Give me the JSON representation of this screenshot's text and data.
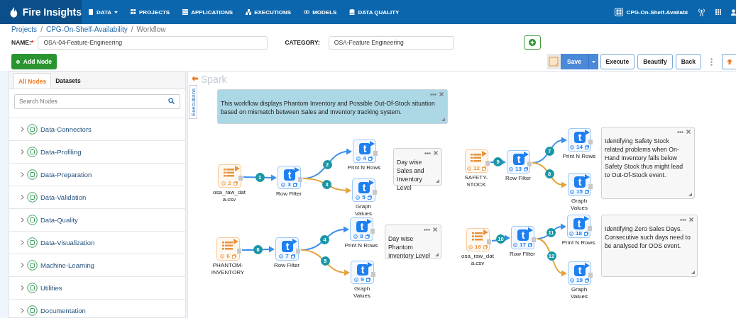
{
  "navbar": {
    "logo": "Fire Insights",
    "items": [
      {
        "label": "DATA",
        "dropdown": true
      },
      {
        "label": "PROJECTS",
        "dropdown": false
      },
      {
        "label": "APPLICATIONS",
        "dropdown": false
      },
      {
        "label": "EXECUTIONS",
        "dropdown": false
      },
      {
        "label": "MODELS",
        "dropdown": false
      },
      {
        "label": "DATA QUALITY",
        "dropdown": false
      }
    ],
    "project": "CPG-On-Shelf-Availabi"
  },
  "breadcrumb": {
    "separator": "/",
    "items": [
      "Projects",
      "CPG-On-Shelf-Availability",
      "Workflow"
    ]
  },
  "form": {
    "name_label": "NAME:",
    "required_mark": "*",
    "name_value": "OSA-04-Feature-Engineering",
    "category_label": "CATEGORY:",
    "category_value": "OSA-Feature Engineering"
  },
  "add_node": "Add Node",
  "toolbar": {
    "save": "Save",
    "buttons": [
      "Execute",
      "Beautify",
      "Back"
    ]
  },
  "sidebar": {
    "tabs": [
      {
        "label": "All Nodes",
        "selected": true
      },
      {
        "label": "Datasets",
        "selected": false
      }
    ],
    "search_placeholder": "Search Nodes",
    "categories": [
      {
        "label": "Data-Connectors",
        "expanded": false
      },
      {
        "label": "Data-Profiling",
        "expanded": false
      },
      {
        "label": "Data-Preparation",
        "expanded": false
      },
      {
        "label": "Data-Validation",
        "expanded": false
      },
      {
        "label": "Data-Quality",
        "expanded": false
      },
      {
        "label": "Data-Visualization",
        "expanded": false
      },
      {
        "label": "Machine-Learning",
        "expanded": false
      },
      {
        "label": "Utilities",
        "expanded": false
      },
      {
        "label": "Documentation",
        "expanded": false
      }
    ]
  },
  "canvas": {
    "engine": "Spark",
    "executions_tab": "Executions",
    "notes": [
      {
        "text": "This workflow displays Phantom Inventory and Possible Out-Of-Stock situation based on mismatch between Sales and Inventory tracking system.",
        "color": "#acd7e4"
      },
      {
        "text": "Day wise Sales and Inventory Level",
        "color": "#f7f7f8"
      },
      {
        "text": "Identifying Safety Stock related problems when On-Hand Inventory falls below Safety Stock thus might lead to Out-Of-Stock event.",
        "color": "#f7f7f8"
      },
      {
        "text": "Day wise Phantom Inventory Level",
        "color": "#f7f7f8"
      },
      {
        "text": "Identifying Zero Sales Days. Consecutive such days need to be analysed for OOS event.",
        "color": "#f7f7f8"
      }
    ],
    "nodes": [
      {
        "kind": "dataset",
        "number": "2",
        "label": "osa_raw_dat a.csv"
      },
      {
        "kind": "transform",
        "glyph": "t",
        "number": "3",
        "label": "Row Filter"
      },
      {
        "kind": "transform",
        "glyph": "t",
        "number": "4",
        "label": "Print N Rows"
      },
      {
        "kind": "transform",
        "glyph": "t",
        "number": "5",
        "label": "Graph Values"
      },
      {
        "kind": "dataset",
        "number": "12",
        "label": "SAFETY- STOCK"
      },
      {
        "kind": "transform",
        "glyph": "t",
        "number": "13",
        "label": "Row Filter"
      },
      {
        "kind": "transform",
        "glyph": "t",
        "number": "14",
        "label": "Print N Rows"
      },
      {
        "kind": "transform",
        "glyph": "t",
        "number": "15",
        "label": "Graph Values"
      },
      {
        "kind": "dataset",
        "number": "6",
        "label": "PHANTOM- INVENTORY"
      },
      {
        "kind": "transform",
        "glyph": "t",
        "number": "7",
        "label": "Row Filter"
      },
      {
        "kind": "transform",
        "glyph": "t",
        "number": "8",
        "label": "Print N Rows"
      },
      {
        "kind": "transform",
        "glyph": "t",
        "number": "9",
        "label": "Graph Values"
      },
      {
        "kind": "dataset",
        "number": "16",
        "label": "osa_raw_dat a.csv"
      },
      {
        "kind": "transform",
        "glyph": "t",
        "number": "17",
        "label": "Row Filter"
      },
      {
        "kind": "transform",
        "glyph": "t",
        "number": "18",
        "label": "Print N Rows"
      },
      {
        "kind": "transform",
        "glyph": "t",
        "number": "19",
        "label": "Graph Values"
      }
    ],
    "edges": [
      {
        "number": "1",
        "color": "#3b8fe8"
      },
      {
        "number": "2",
        "color": "#3b8fe8"
      },
      {
        "number": "3",
        "color": "#e2a43c"
      },
      {
        "number": "9",
        "color": "#3b8fe8"
      },
      {
        "number": "7",
        "color": "#3b8fe8"
      },
      {
        "number": "8",
        "color": "#e2a43c"
      },
      {
        "number": "6",
        "color": "#3b8fe8"
      },
      {
        "number": "4",
        "color": "#3b8fe8"
      },
      {
        "number": "5",
        "color": "#e2a43c"
      },
      {
        "number": "10",
        "color": "#3b8fe8"
      },
      {
        "number": "11",
        "color": "#3b8fe8"
      },
      {
        "number": "12",
        "color": "#e2a43c"
      }
    ]
  }
}
